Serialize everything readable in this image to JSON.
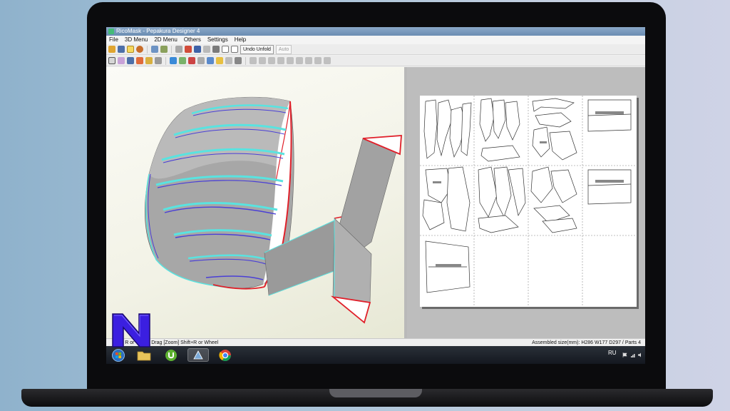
{
  "window": {
    "title": "RicoMask - Pepakura Designer 4"
  },
  "menu": [
    "File",
    "3D Menu",
    "2D Menu",
    "Others",
    "Settings",
    "Help"
  ],
  "toolbar": {
    "undo_unfold_label": "Undo Unfold",
    "auto_label": "Auto"
  },
  "status": {
    "left_text": "[Pan] R or Wheel Drag [Zoom] Shift+R or Wheel",
    "right_text": "Assembled size(mm): H286 W177 D297 / Parts 4"
  },
  "taskbar": {
    "language": "RU",
    "apps": [
      "windows-start",
      "file-explorer",
      "utorrent",
      "pepakura-designer",
      "chrome"
    ]
  },
  "sheet": {
    "pages": [
      {
        "row": 1,
        "col": 1,
        "label": ""
      },
      {
        "row": 1,
        "col": 2,
        "label": ""
      },
      {
        "row": 1,
        "col": 3,
        "label": ""
      },
      {
        "row": 1,
        "col": 4,
        "label": ""
      },
      {
        "row": 2,
        "col": 1,
        "label": ""
      },
      {
        "row": 2,
        "col": 2,
        "label": ""
      },
      {
        "row": 2,
        "col": 3,
        "label": ""
      },
      {
        "row": 2,
        "col": 4,
        "label": ""
      },
      {
        "row": 3,
        "col": 1,
        "label": ""
      },
      {
        "row": 3,
        "col": 2,
        "label": ""
      },
      {
        "row": 3,
        "col": 3,
        "label": ""
      },
      {
        "row": 3,
        "col": 4,
        "label": ""
      }
    ]
  },
  "overlay_logo": {
    "letter": "N",
    "color": "#3b1fe0"
  },
  "colors": {
    "edge_red": "#e0202a",
    "edge_cyan": "#59e3e0",
    "edge_blue": "#4a3fd6",
    "mesh_gray": "#a9a9a9"
  }
}
